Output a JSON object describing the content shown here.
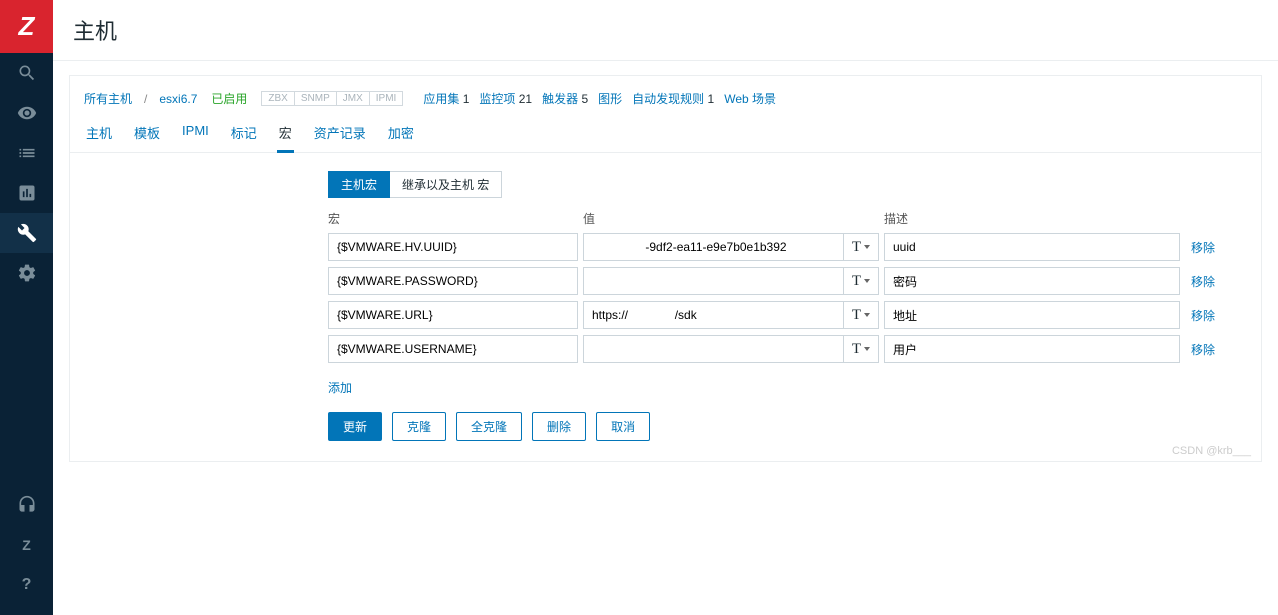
{
  "page": {
    "title": "主机"
  },
  "breadcrumb": {
    "allHosts": "所有主机",
    "host": "esxi6.7",
    "status": "已启用"
  },
  "availTags": [
    "ZBX",
    "SNMP",
    "JMX",
    "IPMI"
  ],
  "infoLinks": [
    {
      "label": "应用集",
      "count": "1"
    },
    {
      "label": "监控项",
      "count": "21"
    },
    {
      "label": "触发器",
      "count": "5"
    },
    {
      "label": "图形",
      "count": ""
    },
    {
      "label": "自动发现规则",
      "count": "1"
    },
    {
      "label": "Web 场景",
      "count": ""
    }
  ],
  "tabs": [
    "主机",
    "模板",
    "IPMI",
    "标记",
    "宏",
    "资产记录",
    "加密"
  ],
  "activeTab": 4,
  "toggle": {
    "a": "主机宏",
    "b": "继承以及主机 宏"
  },
  "headers": {
    "macro": "宏",
    "value": "值",
    "desc": "描述"
  },
  "macros": [
    {
      "name": "{$VMWARE.HV.UUID}",
      "value": "                -9df2-ea11-e9e7b0e1b392",
      "desc": "uuid",
      "remove": "移除"
    },
    {
      "name": "{$VMWARE.PASSWORD}",
      "value": "",
      "desc": "密码",
      "remove": "移除"
    },
    {
      "name": "{$VMWARE.URL}",
      "value": "https://              /sdk",
      "desc": "地址",
      "remove": "移除"
    },
    {
      "name": "{$VMWARE.USERNAME}",
      "value": "",
      "desc": "用户",
      "remove": "移除"
    }
  ],
  "addLink": "添加",
  "actions": {
    "update": "更新",
    "clone": "克隆",
    "fullClone": "全克隆",
    "delete": "删除",
    "cancel": "取消"
  },
  "typeBtn": "T",
  "watermark": "CSDN @krb___"
}
